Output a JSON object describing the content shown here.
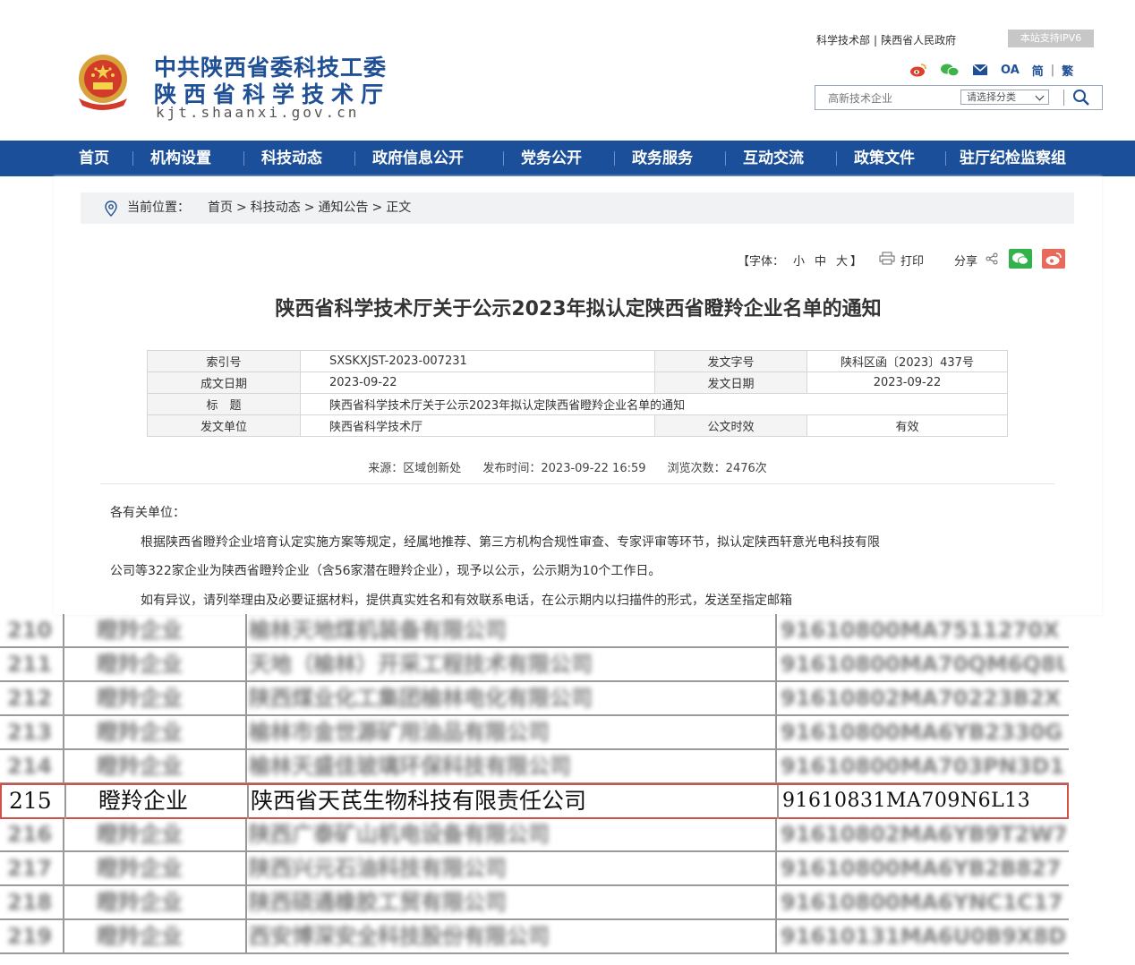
{
  "header": {
    "title_line1": "中共陕西省委科技工委",
    "title_line2": "陕西省科学技术厅",
    "domain": "kjt.shaanxi.gov.cn",
    "top_link_1": "科学技术部",
    "top_link_sep": "|",
    "top_link_2": "陕西省人民政府",
    "ipv6_badge": "本站支持IPV6",
    "oa_label": "OA",
    "simplified_label": "简",
    "traditional_label": "繁",
    "lang_sep": "|",
    "search_value": "高新技术企业",
    "search_category": "请选择分类"
  },
  "nav": {
    "items": [
      "首页",
      "机构设置",
      "科技动态",
      "政府信息公开",
      "党务公开",
      "政务服务",
      "互动交流",
      "政策文件",
      "驻厅纪检监察组"
    ]
  },
  "breadcrumb": {
    "label": "当前位置：",
    "items": [
      "首页",
      "科技动态",
      "通知公告",
      "正文"
    ],
    "separator": ">"
  },
  "tools": {
    "font_label": "【字体：",
    "font_small": "小",
    "font_medium": "中",
    "font_large": "大",
    "font_close": "】",
    "print": "打印",
    "share": "分享"
  },
  "article": {
    "title": "陕西省科学技术厅关于公示2023年拟认定陕西省瞪羚企业名单的通知",
    "meta": {
      "index_label": "索引号",
      "index_value": "SXSKXJST-2023-007231",
      "docno_label": "发文字号",
      "docno_value": "陕科区函〔2023〕437号",
      "created_label": "成文日期",
      "created_value": "2023-09-22",
      "issued_label": "发文日期",
      "issued_value": "2023-09-22",
      "subject_label": "标　题",
      "subject_value": "陕西省科学技术厅关于公示2023年拟认定陕西省瞪羚企业名单的通知",
      "unit_label": "发文单位",
      "unit_value": "陕西省科学技术厅",
      "validity_label": "公文时效",
      "validity_value": "有效"
    },
    "source": "来源：区域创新处",
    "publish_time": "发布时间：2023-09-22 16:59",
    "views": "浏览次数：2476次",
    "salutation": "各有关单位：",
    "para1_line1": "根据陕西省瞪羚企业培育认定实施方案等规定，经属地推荐、第三方机构合规性审查、专家评审等环节，拟认定陕西轩意光电科技有限",
    "para1_line2": "公司等322家企业为陕西省瞪羚企业（含56家潜在瞪羚企业），现予以公示，公示期为10个工作日。",
    "para2": "如有异议，请列举理由及必要证据材料，提供真实姓名和有效联系电话，在公示期内以扫描件的形式，发送至指定邮箱"
  },
  "list_table": {
    "rows": [
      {
        "no": "210",
        "type": "瞪羚企业",
        "name": "榆林天地煤机装备有限公司",
        "code": "91610800MA7511270X"
      },
      {
        "no": "211",
        "type": "瞪羚企业",
        "name": "天地（榆林）开采工程技术有限公司",
        "code": "91610800MA70QM6Q8U"
      },
      {
        "no": "212",
        "type": "瞪羚企业",
        "name": "陕西煤业化工集团榆林电化有限公司",
        "code": "91610802MA70223B2X"
      },
      {
        "no": "213",
        "type": "瞪羚企业",
        "name": "榆林市金世源矿用油品有限公司",
        "code": "91610800MA6YB2330G"
      },
      {
        "no": "214",
        "type": "瞪羚企业",
        "name": "榆林天盛佳玻璃环保科技有限公司",
        "code": "91610800MA703PN3D1"
      },
      {
        "no": "215",
        "type": "瞪羚企业",
        "name": "陕西省天芪生物科技有限责任公司",
        "code": "91610831MA709N6L13",
        "highlighted": true
      },
      {
        "no": "216",
        "type": "瞪羚企业",
        "name": "陕西广泰矿山机电设备有限公司",
        "code": "91610802MA6YB9T2W7"
      },
      {
        "no": "217",
        "type": "瞪羚企业",
        "name": "陕西兴元石油科技有限公司",
        "code": "91610800MA6YB2B827"
      },
      {
        "no": "218",
        "type": "瞪羚企业",
        "name": "陕西硕通橡胶工贸有限公司",
        "code": "91610800MA6YNC1C17"
      },
      {
        "no": "219",
        "type": "瞪羚企业",
        "name": "西安博深安全科技股份有限公司",
        "code": "91610131MA6U0B9X8D"
      }
    ]
  },
  "colors": {
    "brand_blue": "#1b4f99",
    "title_blue": "#1f4f95",
    "highlight_red": "#d0504a",
    "wechat_green": "#32b24a",
    "weibo_red": "#e86a5a"
  }
}
